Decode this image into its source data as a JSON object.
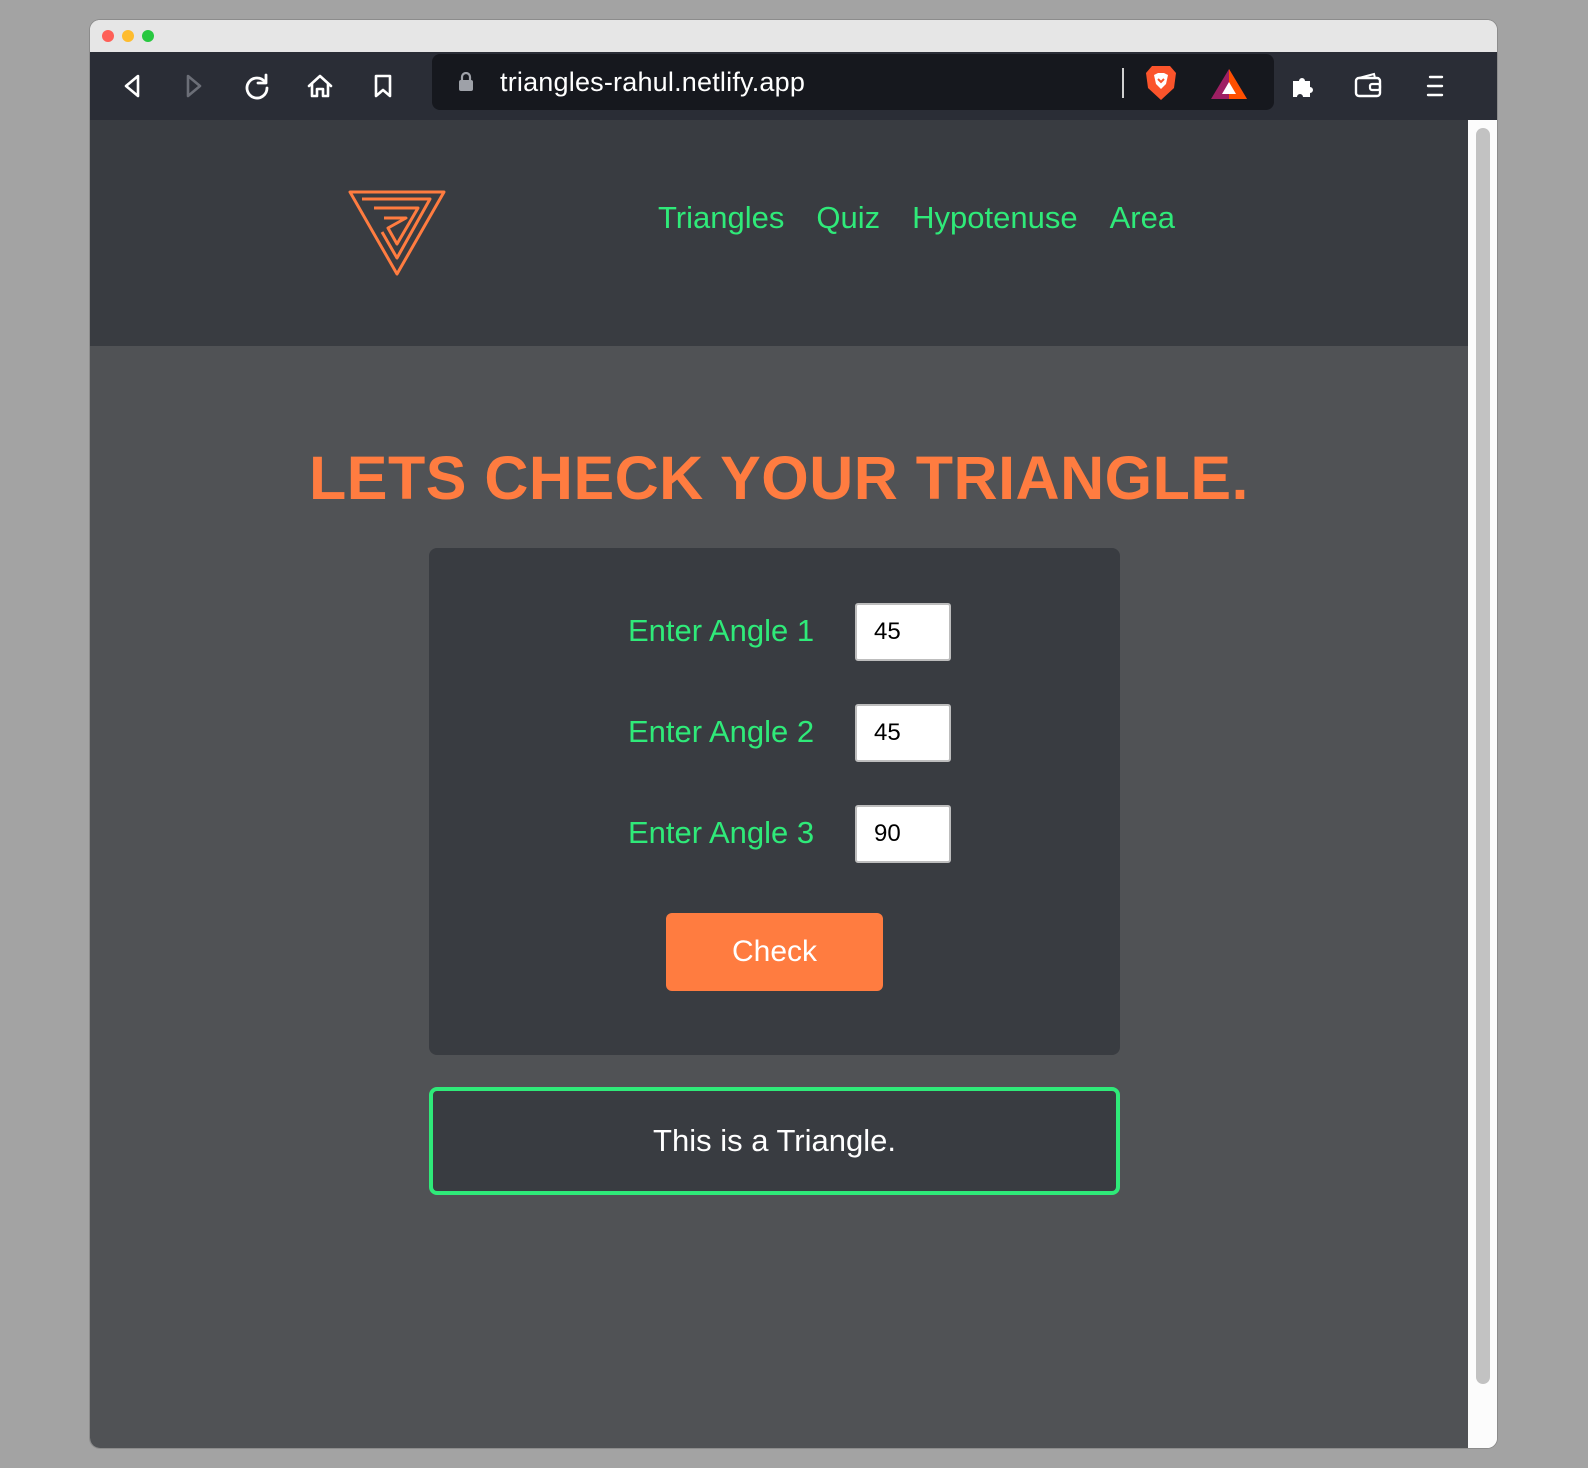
{
  "browser": {
    "url": "triangles-rahul.netlify.app",
    "toolbar_icons": [
      "back-icon",
      "forward-icon",
      "reload-icon",
      "home-icon",
      "bookmark-icon",
      "lock-icon",
      "brave-shield-icon",
      "bat-rewards-icon",
      "extensions-icon",
      "wallet-icon",
      "menu-icon"
    ]
  },
  "header": {
    "logo_icon": "impossible-triangle-logo-icon",
    "nav": {
      "triangles": "Triangles",
      "quiz": "Quiz",
      "hypotenuse": "Hypotenuse",
      "area": "Area"
    }
  },
  "main": {
    "title": "LETS CHECK YOUR TRIANGLE.",
    "angle1": {
      "label": "Enter Angle 1",
      "value": "45"
    },
    "angle2": {
      "label": "Enter Angle 2",
      "value": "45"
    },
    "angle3": {
      "label": "Enter Angle 3",
      "value": "90"
    },
    "check_label": "Check",
    "result": "This is a Triangle."
  },
  "colors": {
    "accent_orange": "#ff7c40",
    "accent_green": "#2fea79",
    "header_bg": "#393c41",
    "page_bg": "#505255"
  }
}
